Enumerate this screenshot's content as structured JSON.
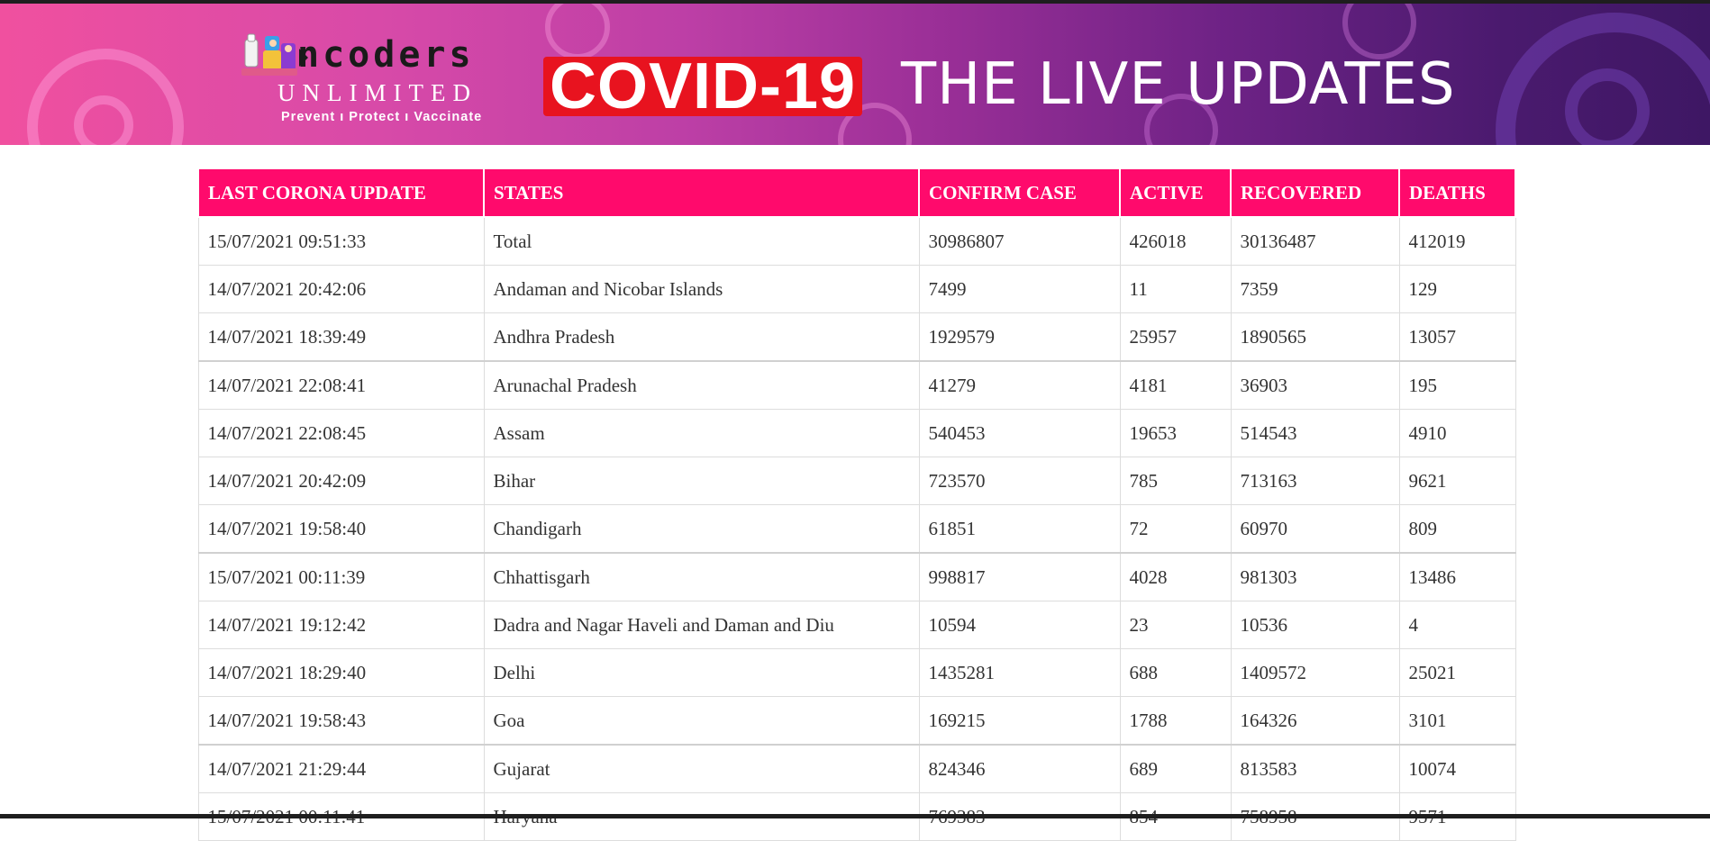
{
  "banner": {
    "logo_word": "ncoders",
    "logo_sub": "UNLIMITED",
    "logo_tagline": "Prevent  ı  Protect  ı  Vaccinate",
    "covid_title": "COVID-19",
    "live_title": "THE LIVE UPDATES",
    "colors": {
      "title_box": "#e8131f",
      "gradient_left": "#f0509f",
      "gradient_right": "#3e1764"
    }
  },
  "table": {
    "header_color": "#ff0a6c",
    "headers": [
      "LAST CORONA UPDATE",
      "STATES",
      "CONFIRM CASE",
      "ACTIVE",
      "RECOVERED",
      "DEATHS"
    ],
    "rows": [
      [
        "15/07/2021 09:51:33",
        "Total",
        "30986807",
        "426018",
        "30136487",
        "412019"
      ],
      [
        "14/07/2021 20:42:06",
        "Andaman and Nicobar Islands",
        "7499",
        "11",
        "7359",
        "129"
      ],
      [
        "14/07/2021 18:39:49",
        "Andhra Pradesh",
        "1929579",
        "25957",
        "1890565",
        "13057"
      ],
      [
        "14/07/2021 22:08:41",
        "Arunachal Pradesh",
        "41279",
        "4181",
        "36903",
        "195"
      ],
      [
        "14/07/2021 22:08:45",
        "Assam",
        "540453",
        "19653",
        "514543",
        "4910"
      ],
      [
        "14/07/2021 20:42:09",
        "Bihar",
        "723570",
        "785",
        "713163",
        "9621"
      ],
      [
        "14/07/2021 19:58:40",
        "Chandigarh",
        "61851",
        "72",
        "60970",
        "809"
      ],
      [
        "15/07/2021 00:11:39",
        "Chhattisgarh",
        "998817",
        "4028",
        "981303",
        "13486"
      ],
      [
        "14/07/2021 19:12:42",
        "Dadra and Nagar Haveli and Daman and Diu",
        "10594",
        "23",
        "10536",
        "4"
      ],
      [
        "14/07/2021 18:29:40",
        "Delhi",
        "1435281",
        "688",
        "1409572",
        "25021"
      ],
      [
        "14/07/2021 19:58:43",
        "Goa",
        "169215",
        "1788",
        "164326",
        "3101"
      ],
      [
        "14/07/2021 21:29:44",
        "Gujarat",
        "824346",
        "689",
        "813583",
        "10074"
      ],
      [
        "15/07/2021 00:11:41",
        "Haryana",
        "769383",
        "854",
        "758958",
        "9571"
      ]
    ]
  }
}
